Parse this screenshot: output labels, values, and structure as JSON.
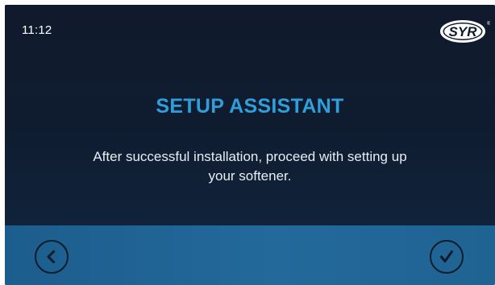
{
  "status_bar": {
    "time": "11:12"
  },
  "brand": {
    "logo_text": "SYR",
    "registered_mark": "®"
  },
  "content": {
    "title": "SETUP ASSISTANT",
    "message_line1": "After successful installation, proceed with setting up",
    "message_line2": "your softener."
  },
  "navigation": {
    "back_icon": "chevron-left-icon",
    "confirm_icon": "checkmark-icon"
  },
  "colors": {
    "background": "#0f1a2b",
    "title_accent": "#2e9fdb",
    "bottom_bar": "#23699a",
    "text": "#e8edf2"
  }
}
